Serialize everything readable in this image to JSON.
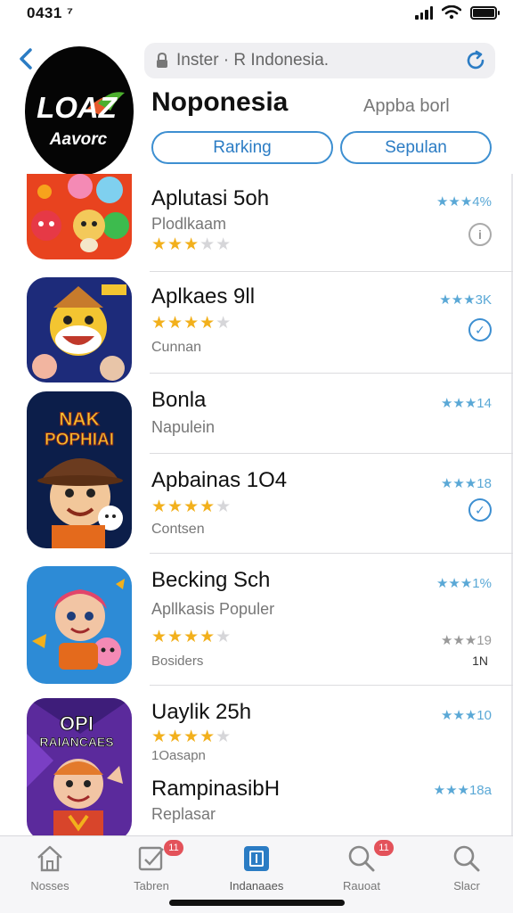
{
  "status_bar": {
    "time": "0431 ⁷",
    "battery_level": 1.0
  },
  "header": {
    "logo_text_top": "LOAZ",
    "logo_text_bottom": "Aavorc",
    "search_value": "Inster · R Indonesia.",
    "title": "Noponesia",
    "subtitle": "Appba borl",
    "segments": [
      {
        "label": "Rarking"
      },
      {
        "label": "Sepulan"
      }
    ]
  },
  "apps": [
    {
      "title": "Aplutasi 5oh",
      "subtitle": "Plodlkaam",
      "stars": 3,
      "rating_text": "★★★4%",
      "action": "info"
    },
    {
      "title": "Aplkaes 9ll",
      "subtitle": "Cunnan",
      "stars": 4,
      "rating_text": "★★★3K",
      "action": "check"
    },
    {
      "title": "Bonla",
      "subtitle": "Napulein",
      "rating_text": "★★★14",
      "thumb_text_1": "NAK",
      "thumb_text_2": "POPHIAI"
    },
    {
      "title": "Apbainas 1O4",
      "subtitle": "Contsen",
      "stars": 4,
      "rating_text": "★★★18",
      "action": "check"
    },
    {
      "title": "Becking Sch",
      "subtitle": "Apllkasis Populer",
      "stars": 4,
      "rating_text": "★★★1%",
      "rating_text_2": "★★★19",
      "caption": "Bosiders",
      "mini_text": "1N"
    },
    {
      "title": "Uaylik 25h",
      "subtitle": "1Oasapn",
      "stars": 4,
      "rating_text": "★★★10",
      "thumb_text_1": "OPI",
      "thumb_text_2": "RAIANCAES"
    },
    {
      "title": "RampinasibH",
      "subtitle": "Replasar",
      "rating_text": "★★★18a"
    }
  ],
  "tabs": [
    {
      "label": "Nosses",
      "icon": "home-icon"
    },
    {
      "label": "Tabren",
      "icon": "edit-icon",
      "badge": "11"
    },
    {
      "label": "Indanaaes",
      "icon": "apps-icon",
      "active": true
    },
    {
      "label": "Rauoat",
      "icon": "search-icon",
      "badge": "11"
    },
    {
      "label": "Slacr",
      "icon": "search-icon"
    }
  ],
  "colors": {
    "accent": "#3d8fd1",
    "star": "#f2b01c",
    "badge": "#e3525a"
  }
}
